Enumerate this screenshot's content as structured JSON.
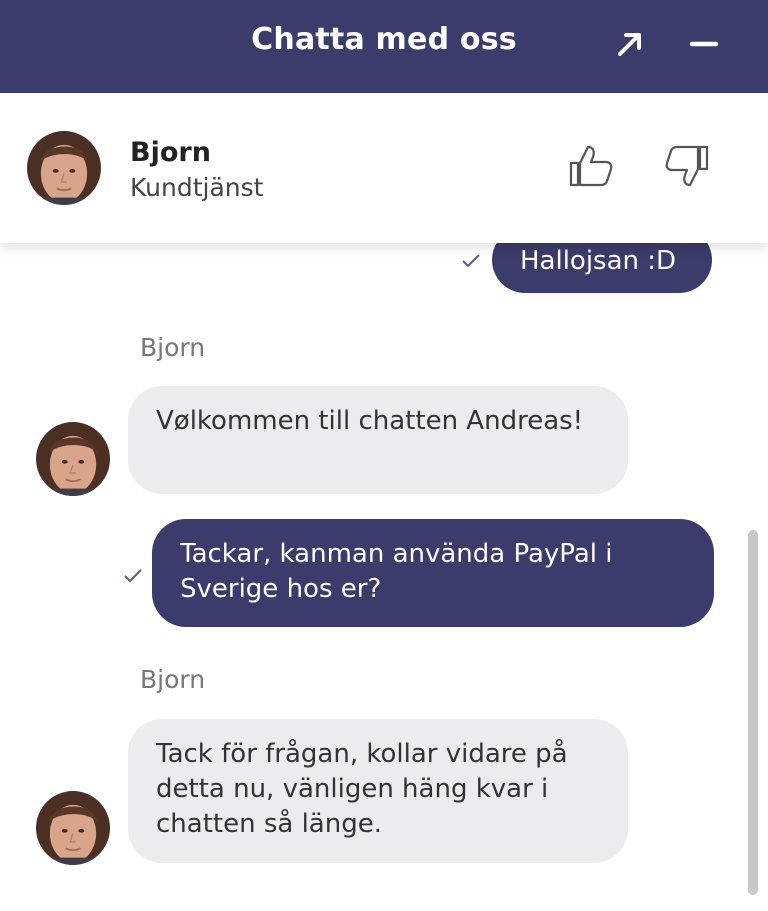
{
  "header": {
    "title": "Chatta med oss",
    "icons": {
      "expand": "arrow-up-right-icon",
      "minimize": "minus-icon"
    }
  },
  "agent": {
    "name": "Bjorn",
    "role": "Kundtjänst",
    "rating_icons": [
      "thumbs-up-icon",
      "thumbs-down-icon"
    ]
  },
  "messages": [
    {
      "from": "user",
      "text": "Hallojsan :D",
      "status_icon": "check-icon"
    },
    {
      "from": "agent",
      "sender": "Bjorn",
      "text": "Vølkommen till chatten Andreas!"
    },
    {
      "from": "user",
      "text": "Tackar, kanman använda PayPal i Sverige hos er?",
      "status_icon": "check-icon"
    },
    {
      "from": "agent",
      "sender": "Bjorn",
      "text": "Tack för frågan, kollar vidare på detta nu, vänligen häng kvar i chatten så länge."
    }
  ],
  "colors": {
    "brand": "#3b3c6b",
    "incoming_bubble": "#ececee",
    "sender_label": "#777777"
  }
}
